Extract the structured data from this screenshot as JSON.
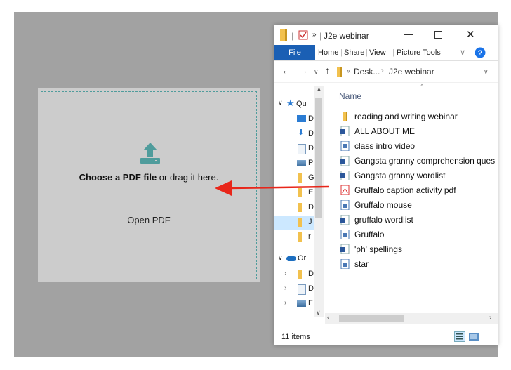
{
  "dropzone": {
    "choose_bold": "Choose a PDF file",
    "choose_rest": " or drag it here.",
    "open_label": "Open PDF",
    "accent": "#4f9c9c"
  },
  "explorer": {
    "title": "J2e webinar",
    "ribbon_tabs": [
      "File",
      "Home",
      "Share",
      "View",
      "Picture Tools"
    ],
    "breadcrumb": [
      "Desk...",
      "J2e webinar"
    ],
    "column_header": "Name",
    "nav_items": [
      {
        "label": "Qu",
        "icon": "star-icon"
      },
      {
        "label": "D",
        "icon": "desktop-icon"
      },
      {
        "label": "D",
        "icon": "download-icon"
      },
      {
        "label": "D",
        "icon": "document-icon"
      },
      {
        "label": "P",
        "icon": "picture-icon"
      },
      {
        "label": "G",
        "icon": "folder-icon"
      },
      {
        "label": "E",
        "icon": "folder-icon"
      },
      {
        "label": "D",
        "icon": "folder-icon"
      },
      {
        "label": "J",
        "icon": "folder-icon"
      },
      {
        "label": "r",
        "icon": "folder-icon"
      },
      {
        "label": "Or",
        "icon": "cloud-icon"
      },
      {
        "label": "D",
        "icon": "folder-icon"
      },
      {
        "label": "D",
        "icon": "document-icon"
      },
      {
        "label": "F",
        "icon": "picture-icon"
      }
    ],
    "files": [
      {
        "name": "reading and writing webinar",
        "icon": "folder-icon"
      },
      {
        "name": "ALL ABOUT ME",
        "icon": "word-doc-icon"
      },
      {
        "name": "class intro video",
        "icon": "video-file-icon"
      },
      {
        "name": "Gangsta granny comprehension ques",
        "icon": "word-doc-icon"
      },
      {
        "name": "Gangsta granny wordlist",
        "icon": "word-doc-icon"
      },
      {
        "name": "Gruffalo caption activity pdf",
        "icon": "pdf-icon"
      },
      {
        "name": "Gruffalo mouse",
        "icon": "image-file-icon"
      },
      {
        "name": "gruffalo wordlist",
        "icon": "word-doc-icon"
      },
      {
        "name": "Gruffalo",
        "icon": "image-file-icon"
      },
      {
        "name": "'ph' spellings",
        "icon": "word-doc-icon"
      },
      {
        "name": "star",
        "icon": "image-file-icon"
      }
    ],
    "status": "11 items"
  },
  "arrow_color": "#e8261a"
}
